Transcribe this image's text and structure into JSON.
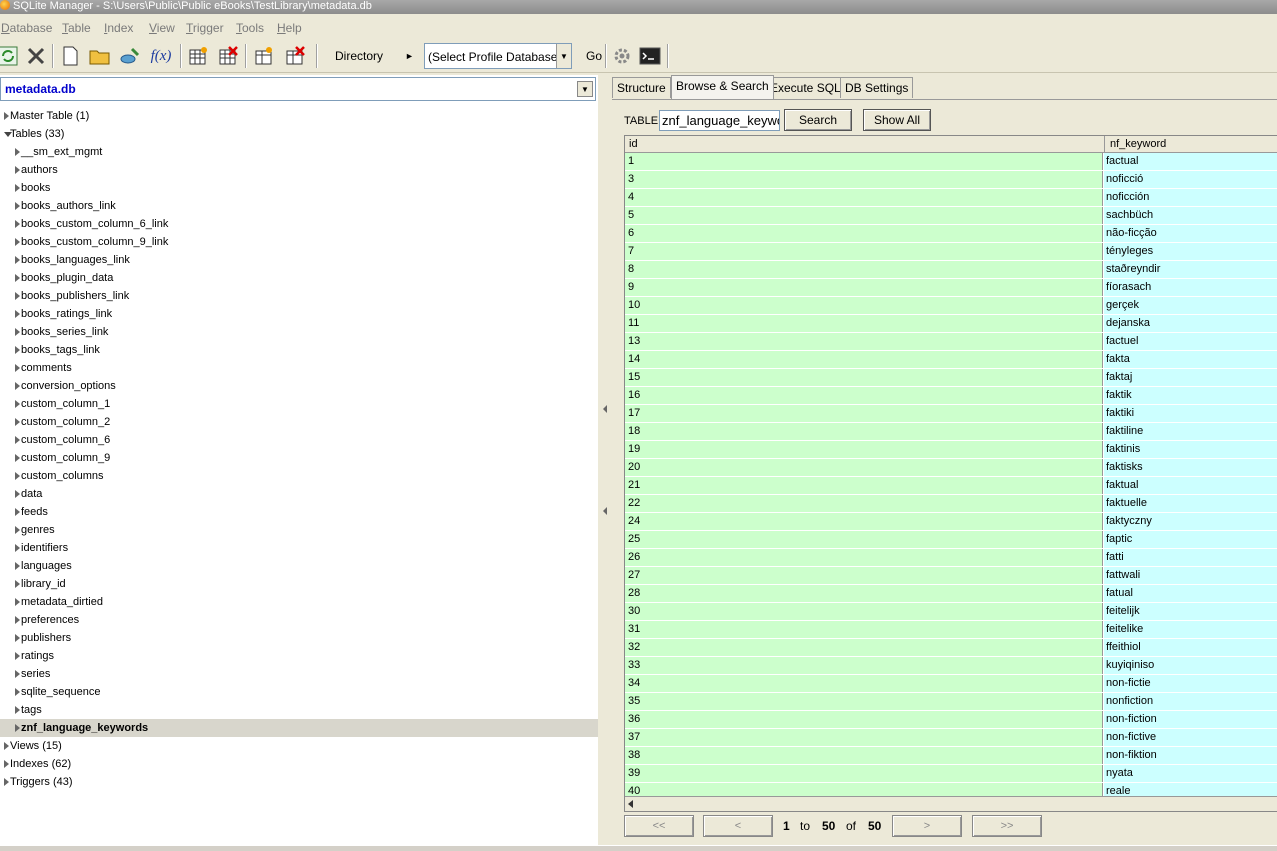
{
  "window": {
    "title": "SQLite Manager - S:\\Users\\Public\\Public eBooks\\TestLibrary\\metadata.db"
  },
  "menu": [
    "Database",
    "Table",
    "Index",
    "View",
    "Trigger",
    "Tools",
    "Help"
  ],
  "toolbar": {
    "directory_label": "Directory",
    "directory_arrow": "►",
    "profile_select": "(Select Profile Database)",
    "go_label": "Go",
    "fx_label": "f(x)"
  },
  "left": {
    "db_name": "metadata.db",
    "tree": [
      {
        "label": "Master Table (1)",
        "level": 0,
        "expanded": false
      },
      {
        "label": "Tables (33)",
        "level": 0,
        "expanded": true
      },
      {
        "label": "__sm_ext_mgmt",
        "level": 1
      },
      {
        "label": "authors",
        "level": 1
      },
      {
        "label": "books",
        "level": 1
      },
      {
        "label": "books_authors_link",
        "level": 1
      },
      {
        "label": "books_custom_column_6_link",
        "level": 1
      },
      {
        "label": "books_custom_column_9_link",
        "level": 1
      },
      {
        "label": "books_languages_link",
        "level": 1
      },
      {
        "label": "books_plugin_data",
        "level": 1
      },
      {
        "label": "books_publishers_link",
        "level": 1
      },
      {
        "label": "books_ratings_link",
        "level": 1
      },
      {
        "label": "books_series_link",
        "level": 1
      },
      {
        "label": "books_tags_link",
        "level": 1
      },
      {
        "label": "comments",
        "level": 1
      },
      {
        "label": "conversion_options",
        "level": 1
      },
      {
        "label": "custom_column_1",
        "level": 1
      },
      {
        "label": "custom_column_2",
        "level": 1
      },
      {
        "label": "custom_column_6",
        "level": 1
      },
      {
        "label": "custom_column_9",
        "level": 1
      },
      {
        "label": "custom_columns",
        "level": 1
      },
      {
        "label": "data",
        "level": 1
      },
      {
        "label": "feeds",
        "level": 1
      },
      {
        "label": "genres",
        "level": 1
      },
      {
        "label": "identifiers",
        "level": 1
      },
      {
        "label": "languages",
        "level": 1
      },
      {
        "label": "library_id",
        "level": 1
      },
      {
        "label": "metadata_dirtied",
        "level": 1
      },
      {
        "label": "preferences",
        "level": 1
      },
      {
        "label": "publishers",
        "level": 1
      },
      {
        "label": "ratings",
        "level": 1
      },
      {
        "label": "series",
        "level": 1
      },
      {
        "label": "sqlite_sequence",
        "level": 1
      },
      {
        "label": "tags",
        "level": 1
      },
      {
        "label": "znf_language_keywords",
        "level": 1,
        "selected": true
      },
      {
        "label": "Views (15)",
        "level": 0,
        "expanded": false
      },
      {
        "label": "Indexes (62)",
        "level": 0,
        "expanded": false
      },
      {
        "label": "Triggers (43)",
        "level": 0,
        "expanded": false
      }
    ]
  },
  "tabs": [
    {
      "label": "Structure",
      "active": false
    },
    {
      "label": "Browse & Search",
      "active": true
    },
    {
      "label": "Execute SQL",
      "active": false
    },
    {
      "label": "DB Settings",
      "active": false
    }
  ],
  "browse": {
    "table_label": "TABLE",
    "table_value": "znf_language_keywords",
    "search_label": "Search",
    "show_all_label": "Show All",
    "columns": [
      "id",
      "nf_keyword"
    ],
    "rows": [
      [
        "1",
        "factual"
      ],
      [
        "3",
        "noficció"
      ],
      [
        "4",
        "noficción"
      ],
      [
        "5",
        "sachbüch"
      ],
      [
        "6",
        "não-ficção"
      ],
      [
        "7",
        "tényleges"
      ],
      [
        "8",
        "staðreyndir"
      ],
      [
        "9",
        "fíorasach"
      ],
      [
        "10",
        "gerçek"
      ],
      [
        "11",
        "dejanska"
      ],
      [
        "13",
        "factuel"
      ],
      [
        "14",
        "fakta"
      ],
      [
        "15",
        "faktaj"
      ],
      [
        "16",
        "faktik"
      ],
      [
        "17",
        "faktiki"
      ],
      [
        "18",
        "faktiline"
      ],
      [
        "19",
        "faktinis"
      ],
      [
        "20",
        "faktisks"
      ],
      [
        "21",
        "faktual"
      ],
      [
        "22",
        "faktuelle"
      ],
      [
        "24",
        "faktyczny"
      ],
      [
        "25",
        "faptic"
      ],
      [
        "26",
        "fatti"
      ],
      [
        "27",
        "fattwali"
      ],
      [
        "28",
        "fatual"
      ],
      [
        "30",
        "feitelijk"
      ],
      [
        "31",
        "feitelike"
      ],
      [
        "32",
        "ffeithiol"
      ],
      [
        "33",
        "kuyiqiniso"
      ],
      [
        "34",
        "non-fictie"
      ],
      [
        "35",
        "nonfiction"
      ],
      [
        "36",
        "non-fiction"
      ],
      [
        "37",
        "non-fictive"
      ],
      [
        "38",
        "non-fiktion"
      ],
      [
        "39",
        "nyata"
      ],
      [
        "40",
        "reale"
      ]
    ]
  },
  "pager": {
    "first": "<<",
    "prev": "<",
    "next": ">",
    "last": ">>",
    "from": "1",
    "to_label": "to",
    "to": "50",
    "of_label": "of",
    "total": "50"
  },
  "colors": {
    "id_cell": "#ccffcc",
    "keyword_cell": "#ccffff",
    "db_name": "#0000cc"
  }
}
